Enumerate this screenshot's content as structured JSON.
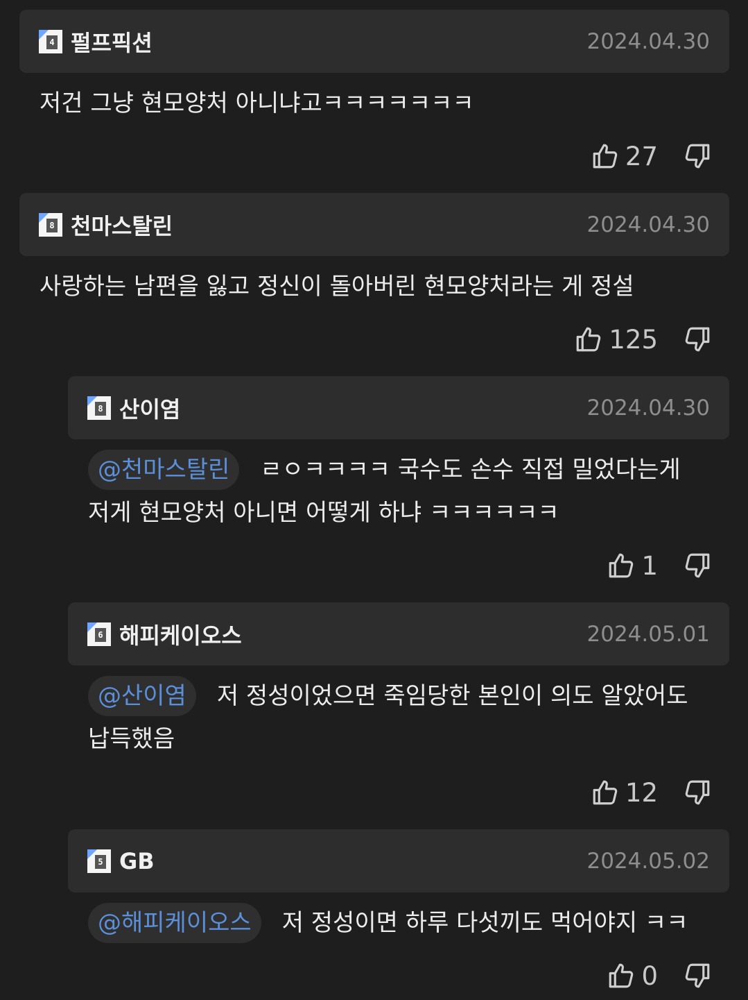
{
  "comments": [
    {
      "nick": "펄프픽션",
      "level": "4",
      "date": "2024.04.30",
      "mention": "",
      "text_lines": [
        "저건 그냥 현모양처 아니냐고ㅋㅋㅋㅋㅋㅋㅋ"
      ],
      "likes": "27"
    },
    {
      "nick": "천마스탈린",
      "level": "8",
      "date": "2024.04.30",
      "mention": "",
      "text_lines": [
        "사랑하는 남편을 잃고 정신이 돌아버린 현모양처라는 게 정설"
      ],
      "likes": "125"
    },
    {
      "nick": "산이염",
      "level": "8",
      "date": "2024.04.30",
      "mention": "@천마스탈린",
      "text_lines": [
        "ㄹㅇㅋㅋㅋㅋ 국수도 손수 직접 밀었다는게",
        "저게 현모양처 아니면 어떻게 하냐 ㅋㅋㅋㅋㅋㅋ"
      ],
      "likes": "1"
    },
    {
      "nick": "해피케이오스",
      "level": "6",
      "date": "2024.05.01",
      "mention": "@산이염",
      "text_lines": [
        "저 정성이었으면 죽임당한 본인이 의도 알았어도",
        "납득했음"
      ],
      "likes": "12"
    },
    {
      "nick": "GB",
      "level": "5",
      "date": "2024.05.02",
      "mention": "@해피케이오스",
      "text_lines": [
        "저 정성이면 하루 다섯끼도 먹어야지 ㅋㅋ"
      ],
      "likes": "0"
    }
  ],
  "icons": {
    "like": "thumbs-up-icon",
    "dislike": "thumbs-down-icon",
    "level": "level-badge-icon"
  },
  "colors": {
    "background": "#1e1e1e",
    "header": "#2d2d2d",
    "mention": "#5b8fd8",
    "date": "#8e8e8e"
  }
}
